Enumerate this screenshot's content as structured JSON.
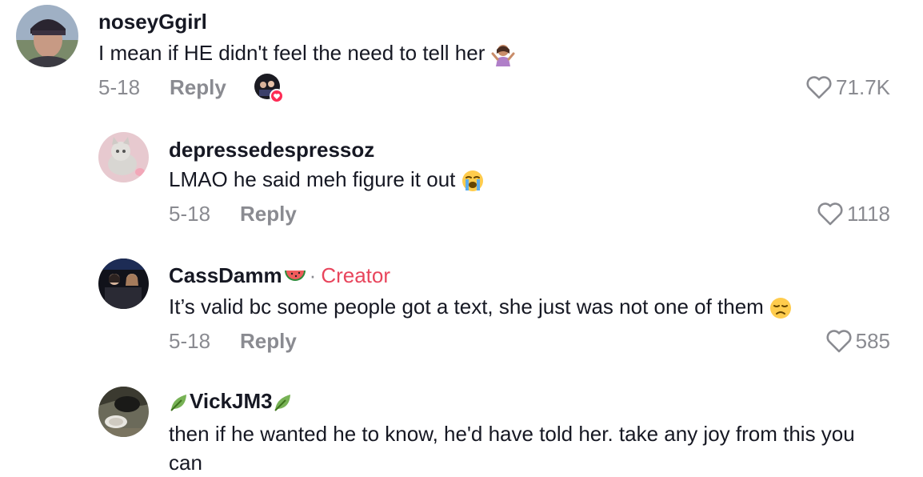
{
  "comments": [
    {
      "username": "noseyGgirl",
      "text": "I mean if HE didn't feel the need to tell her",
      "date": "5-18",
      "reply": "Reply",
      "likes": "71.7K"
    },
    {
      "username": "depressedespressoz",
      "text": "LMAO he said meh figure it out",
      "date": "5-18",
      "reply": "Reply",
      "likes": "1118"
    },
    {
      "username": "CassDamm",
      "creator_separator": "·",
      "creator_label": "Creator",
      "text": "It’s valid bc some people got a text, she just was not one of them",
      "date": "5-18",
      "reply": "Reply",
      "likes": "585"
    },
    {
      "username": "VickJM3",
      "text": "then if he wanted he to know, he'd have told her. take any joy from this you can"
    }
  ],
  "icons": {
    "like": "heart-outline-icon",
    "creator_liked": "creator-liked-avatar-icon",
    "shrug": "woman-shrugging-emoji",
    "crying": "loudly-crying-emoji",
    "sad": "disappointed-emoji",
    "melon": "watermelon-emoji",
    "leaf": "leaf-emoji"
  },
  "colors": {
    "text": "#161823",
    "muted": "#8a8b91",
    "creator": "#e8455c"
  }
}
